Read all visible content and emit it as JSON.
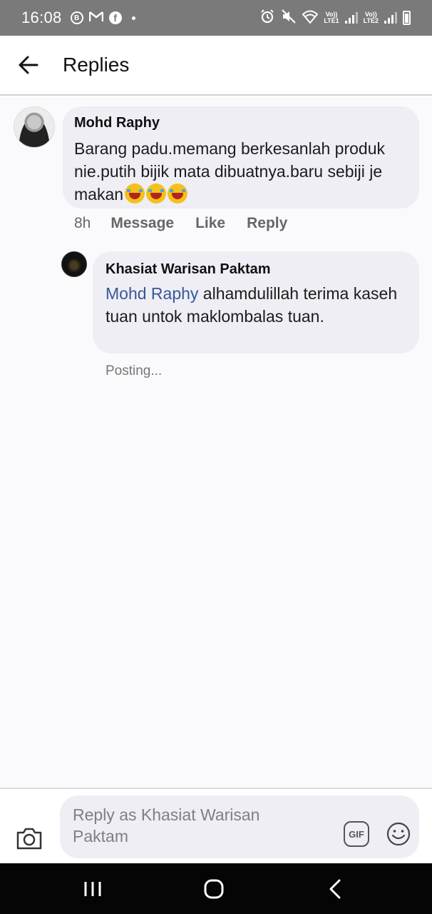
{
  "status_bar": {
    "time": "16:08",
    "left_icons": [
      "b-circle-icon",
      "gmail-icon",
      "facebook-icon",
      "dot-icon"
    ],
    "right_icons": [
      "alarm-icon",
      "mute-icon",
      "wifi-icon",
      "signal-lte1-icon",
      "signal-lte2-icon",
      "battery-icon"
    ],
    "lte1_label": "Vo))\nLTE1",
    "lte2_label": "Vo))\nLTE2",
    "b_label": "B",
    "fb_label": "f"
  },
  "header": {
    "back_icon": "arrow-left-icon",
    "title": "Replies"
  },
  "comment": {
    "author": "Mohd Raphy",
    "text": "Barang padu.memang berkesanlah produk nie.putih bijik mata dibuatnya.baru sebiji je makan",
    "emojis": [
      "tears-of-joy-emoji",
      "tears-of-joy-emoji",
      "tears-of-joy-emoji"
    ],
    "time": "8h",
    "actions": [
      "Message",
      "Like",
      "Reply"
    ]
  },
  "reply": {
    "author": "Khasiat Warisan Paktam",
    "mention": "Mohd Raphy",
    "text": " alhamdulillah terima kaseh tuan untok maklombalas tuan.",
    "status": "Posting..."
  },
  "composer": {
    "placeholder": "Reply as Khasiat Warisan Paktam",
    "gif_label": "GIF",
    "camera_icon": "camera-icon",
    "emoji_icon": "smiley-icon"
  },
  "nav_bar": {
    "icons": [
      "recent-apps-icon",
      "home-icon",
      "back-icon"
    ]
  },
  "colors": {
    "status_bar": "#7a7a7a",
    "bubble": "#eeeef4",
    "mention": "#385898",
    "content_bg": "#fafafc"
  }
}
